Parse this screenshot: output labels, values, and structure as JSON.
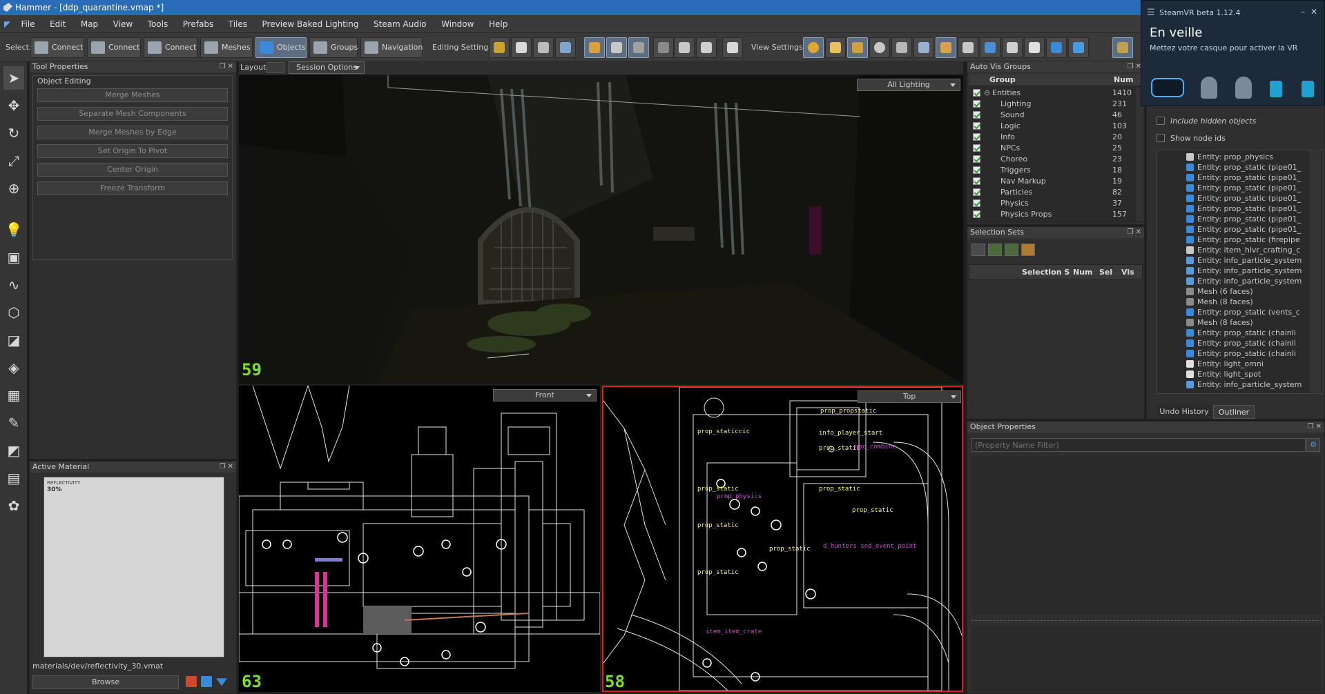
{
  "window": {
    "title": "Hammer - [ddp_quarantine.vmap *]"
  },
  "menu": [
    "File",
    "Edit",
    "Map",
    "View",
    "Tools",
    "Prefabs",
    "Tiles",
    "Preview Baked Lighting",
    "Steam Audio",
    "Window",
    "Help"
  ],
  "toolbar": {
    "select_label": "Select:",
    "select_buttons": [
      "Connect",
      "Connect",
      "Connect",
      "Meshes",
      "Objects",
      "Groups",
      "Navigation"
    ],
    "editing_label": "Editing Settings:",
    "view_label": "View Settings:"
  },
  "tool_properties": {
    "title": "Tool Properties",
    "section": "Object Editing",
    "buttons": [
      "Merge Meshes",
      "Separate Mesh Components",
      "Merge Meshes by Edge",
      "Set Origin To Pivot",
      "Center Origin",
      "Freeze Transform"
    ]
  },
  "layout_bar": {
    "label": "Layout:",
    "session": "Session Options"
  },
  "viewport_3d": {
    "mode": "All Lighting",
    "fps": "59"
  },
  "viewport_front": {
    "mode": "Front",
    "fps": "63"
  },
  "viewport_top": {
    "mode": "Top",
    "fps": "58",
    "labels": [
      "prop_propstatic",
      "info_player_start",
      "prop_static",
      "prop_static",
      "prop_static",
      "prop_static",
      "prop_physics",
      "prop_static",
      "npc_combine",
      "prop_static",
      "item_item_crate",
      "d_hunters snd_event_point",
      "prop_static",
      "prop_staticcic"
    ]
  },
  "active_material": {
    "title": "Active Material",
    "path": "materials/dev/reflectivity_30.vmat",
    "browse": "Browse",
    "preview_text": "REFLECTIVITY",
    "preview_value": "30%"
  },
  "auto_vis": {
    "title": "Auto Vis Groups",
    "col_group": "Group",
    "col_num": "Num",
    "rows": [
      {
        "name": "Entities",
        "num": "1410"
      },
      {
        "name": "Lighting",
        "num": "231"
      },
      {
        "name": "Sound",
        "num": "46"
      },
      {
        "name": "Logic",
        "num": "103"
      },
      {
        "name": "Info",
        "num": "20"
      },
      {
        "name": "NPCs",
        "num": "25"
      },
      {
        "name": "Choreo",
        "num": "23"
      },
      {
        "name": "Triggers",
        "num": "18"
      },
      {
        "name": "Nav Markup",
        "num": "19"
      },
      {
        "name": "Particles",
        "num": "82"
      },
      {
        "name": "Physics",
        "num": "37"
      },
      {
        "name": "Physics Props",
        "num": "157"
      }
    ]
  },
  "selection_sets": {
    "title": "Selection Sets",
    "cols": [
      "Selection S",
      "Num",
      "Sel",
      "Vis"
    ]
  },
  "steamvr": {
    "title": "SteamVR beta 1.12.4",
    "status": "En veille",
    "message": "Mettez votre casque pour activer la VR"
  },
  "outliner": {
    "include_hidden": "Include hidden objects",
    "show_node_ids": "Show node ids",
    "items": [
      "Entity: prop_physics",
      "Entity: prop_static (pipe01_",
      "Entity: prop_static (pipe01_",
      "Entity: prop_static (pipe01_",
      "Entity: prop_static (pipe01_",
      "Entity: prop_static (pipe01_",
      "Entity: prop_static (pipe01_",
      "Entity: prop_static (pipe01_",
      "Entity: prop_static (firepipe",
      "Entity: item_hlvr_crafting_c",
      "Entity: info_particle_system",
      "Entity: info_particle_system",
      "Entity: info_particle_system",
      "Mesh (6 faces)",
      "Mesh (8 faces)",
      "Entity: prop_static (vents_c",
      "Mesh (8 faces)",
      "Entity: prop_static (chainli",
      "Entity: prop_static (chainli",
      "Entity: prop_static (chainli",
      "Entity: light_omni",
      "Entity: light_spot",
      "Entity: info_particle_system"
    ],
    "tabs": [
      "Undo History",
      "Outliner"
    ]
  },
  "object_properties": {
    "title": "Object Properties",
    "filter_placeholder": "(Property Name Filter)"
  }
}
